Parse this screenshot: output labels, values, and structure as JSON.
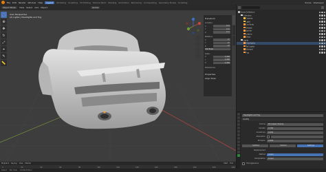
{
  "menubar": {
    "menus": [
      "File",
      "Edit",
      "Render",
      "Window",
      "Help"
    ],
    "workspaces": [
      "Layout",
      "Modeling",
      "Sculpting",
      "UV Editing",
      "Texture Paint",
      "Shading",
      "Animation",
      "Rendering",
      "Compositing",
      "Geometry Nodes",
      "Scripting"
    ],
    "active_workspace": "Layout",
    "scene": "Scene",
    "view_layer": "ViewLayer"
  },
  "viewport": {
    "header": {
      "mode": "Object Mode",
      "menus": [
        "View",
        "Select",
        "Add",
        "Object"
      ],
      "orientation": "Global"
    },
    "info": {
      "line1": "User Perspective",
      "line2": "(2) Lights | Headlights and Fog"
    },
    "npanel": {
      "title": "Transform",
      "location_label": "Location:",
      "location": [
        "0 m",
        "0 m",
        "0 m"
      ],
      "rotation_label": "Rotation:",
      "rotation": [
        "0°",
        "0°",
        "0°"
      ],
      "rotation_mode": "XYZ Euler",
      "scale_label": "Scale:",
      "scale": [
        "1.000",
        "1.000",
        "1.000"
      ],
      "dimensions_label": "Dimensions:",
      "properties": "Properties",
      "align_tools": "Align Tools",
      "axes": [
        "X",
        "Y",
        "Z"
      ]
    }
  },
  "timeline": {
    "menus": [
      "Playback",
      "Keying",
      "View",
      "Marker"
    ],
    "frame_start": "Start",
    "frame_end": "End",
    "ticks": [
      "0",
      "20",
      "40",
      "60",
      "80",
      "100",
      "120",
      "140",
      "160",
      "180",
      "200",
      "220",
      "240"
    ]
  },
  "statusbar": {
    "items": [
      "Select",
      "Pan View",
      "Context Menu"
    ]
  },
  "outliner": {
    "rows": [
      {
        "label": "Scene Collection",
        "indent": 0,
        "color": "#bfbfbf",
        "selected": false
      },
      {
        "label": "Collection",
        "indent": 1,
        "color": "#dcdcdc",
        "selected": false
      },
      {
        "label": "Camera",
        "indent": 2,
        "color": "#f0c040",
        "selected": false
      },
      {
        "label": "Light",
        "indent": 2,
        "color": "#f0c040",
        "selected": false
      },
      {
        "label": "Car Body",
        "indent": 2,
        "color": "#ff9a3c",
        "selected": false
      },
      {
        "label": "Wheels",
        "indent": 2,
        "color": "#ff9a3c",
        "selected": false
      },
      {
        "label": "Spoiler",
        "indent": 2,
        "color": "#ff9a3c",
        "selected": false
      },
      {
        "label": "Interior",
        "indent": 2,
        "color": "#ff9a3c",
        "selected": false
      },
      {
        "label": "Glass",
        "indent": 2,
        "color": "#ff9a3c",
        "selected": false
      },
      {
        "label": "Lights",
        "indent": 1,
        "color": "#dcdcdc",
        "selected": false
      },
      {
        "label": "Headlights",
        "indent": 2,
        "color": "#ff9a3c",
        "selected": true
      },
      {
        "label": "Tail Lights",
        "indent": 2,
        "color": "#ff9a3c",
        "selected": false
      },
      {
        "label": "Exhaust",
        "indent": 2,
        "color": "#ff9a3c",
        "selected": false
      },
      {
        "label": "Fog",
        "indent": 2,
        "color": "#ff9a3c",
        "selected": false
      }
    ]
  },
  "properties": {
    "object_name": "Headlights and Fog",
    "modifier": "Solidify",
    "sections": [
      {
        "label": "Volume",
        "value": "Principled Volume"
      },
      {
        "label": "Density",
        "value": "0.100"
      },
      {
        "label": "Anisotropy",
        "value": "0.000"
      },
      {
        "label": "Absorption",
        "value": ""
      },
      {
        "label": "Emission",
        "value": "0.000"
      }
    ],
    "surface_tab": "Surface",
    "volume_tab": "Volume",
    "settings_tab": "Settings",
    "displacement_label": "Displacement",
    "method_label": "Method",
    "method_value": "Linear",
    "interp_label": "Interpolation",
    "interp_value": "Linear",
    "homogeneous": "Homogeneous"
  },
  "colors": {
    "accent": "#4772b3",
    "viewport_bg": "#3d3d3d",
    "car_body": "#cfcfcf"
  }
}
